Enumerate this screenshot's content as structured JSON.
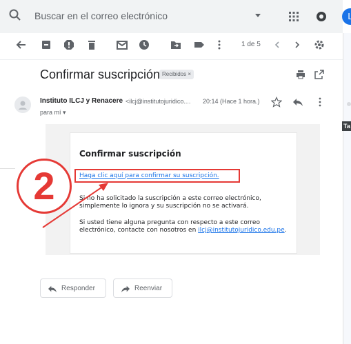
{
  "search": {
    "placeholder": "Buscar en el correo electrónico"
  },
  "account": {
    "avatar_letter": "L"
  },
  "toolbar": {
    "pager": "1 de 5"
  },
  "message": {
    "subject": "Confirmar suscripción",
    "label": "Recibidos ×",
    "sender_name": "Instituto ILCJ y Renacere",
    "sender_email": "<ilcj@institutojuridico....",
    "time": "20:14 (Hace 1 hora.)",
    "to": "para mí ▾"
  },
  "body": {
    "title": "Confirmar suscripción",
    "link": "Haga clic aquí para confirmar su suscripción.",
    "paragraph1": "Si no ha solicitado la suscripción a este correo electrónico, simplemente lo ignora y su suscripción no se activará.",
    "paragraph2": "Si usted tiene alguna pregunta con respecto a este correo electrónico, contacte con nosotros en",
    "contact_email": "ilcj@institutojuridico.edu.pe",
    "paragraph2_end": "."
  },
  "annotation": {
    "step_number": "2"
  },
  "actions": {
    "reply": "Responder",
    "forward": "Reenviar"
  },
  "rail": {
    "chip_label": "Ta"
  },
  "colors": {
    "accent": "#1a73e8",
    "annotation": "#e53935"
  }
}
